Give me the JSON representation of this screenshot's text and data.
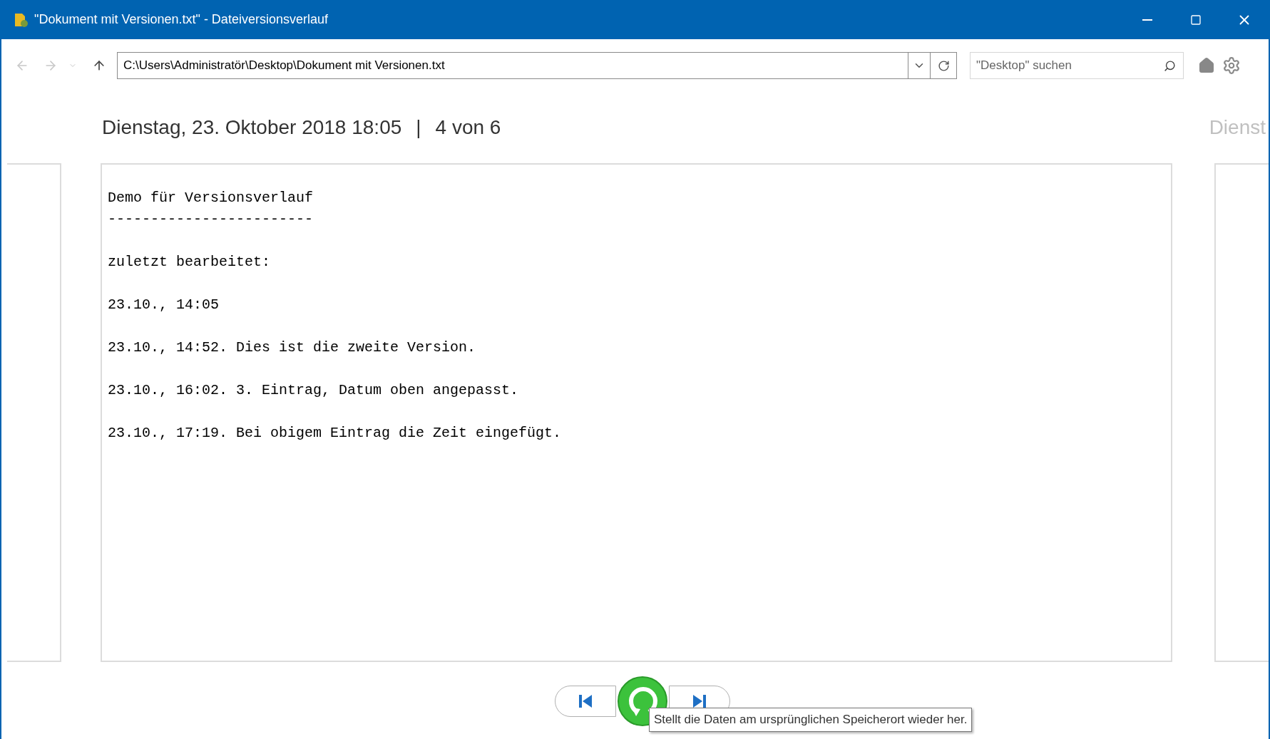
{
  "window": {
    "title": "\"Dokument mit Versionen.txt\" - Dateiversionsverlauf"
  },
  "toolbar": {
    "back_disabled": true,
    "forward_disabled": true,
    "path": "C:\\Users\\Administratör\\Desktop\\Dokument mit Versionen.txt",
    "search_placeholder": "\"Desktop\" suchen"
  },
  "version": {
    "date": "Dienstag, 23. Oktober 2018 18:05",
    "separator": "|",
    "position": "4 von 6"
  },
  "next_version": {
    "title": "Dienst"
  },
  "document": {
    "blocks": [
      {
        "lines": [
          "Demo für Versionsverlauf",
          "------------------------"
        ]
      },
      {
        "lines": [
          "zuletzt bearbeitet:"
        ]
      },
      {
        "lines": [
          "23.10., 14:05"
        ]
      },
      {
        "lines": [
          "23.10., 14:52. Dies ist die zweite Version."
        ]
      },
      {
        "lines": [
          "23.10., 16:02. 3. Eintrag, Datum oben angepasst."
        ]
      },
      {
        "lines": [
          "23.10., 17:19. Bei obigem Eintrag die Zeit eingefügt."
        ]
      }
    ]
  },
  "tooltip": "Stellt die Daten am ursprünglichen Speicherort wieder her."
}
